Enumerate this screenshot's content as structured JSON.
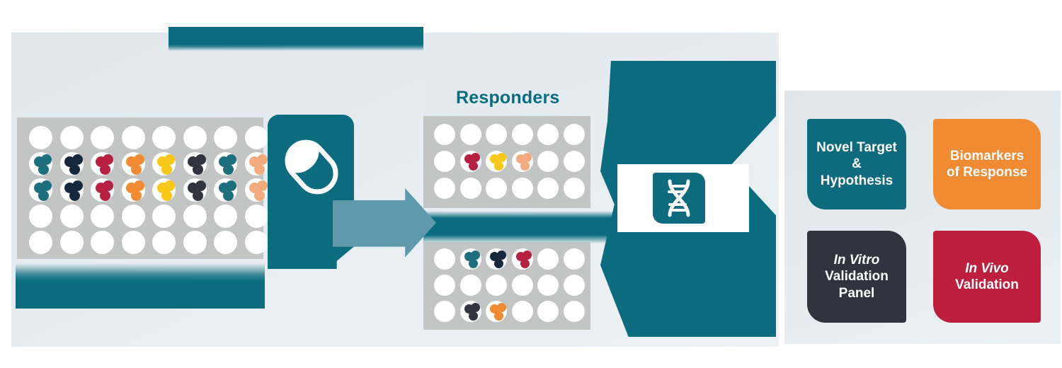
{
  "title": "Drug response screening to novel target discovery workflow",
  "colors": {
    "teal": "#0a6c7e",
    "teal_card": "#0d6b7d",
    "orange": "#f08b33",
    "navy": "#31343f",
    "crimson": "#bd1f3c",
    "plate_gray": "#c3c4c4",
    "well_white": "#ffffff",
    "connector_blue": "#5e9aab",
    "panel_bg": "#e5ecf1"
  },
  "captions": {
    "responders": "Responders"
  },
  "clipped_text": {
    "top_strip": "",
    "bottom_strip": "",
    "mid_strip": ""
  },
  "icons": {
    "pill": "pill-capsule-icon",
    "dna": "dna-helix-icon"
  },
  "cell_colors": {
    "teal": "#1d6f7d",
    "navy": "#16283c",
    "crimson": "#b7203f",
    "orange": "#f08b33",
    "yellow": "#f9c717",
    "charcoal": "#31343f",
    "peach": "#f3ab7e"
  },
  "plates": {
    "main": {
      "name": "compound-screening-plate",
      "rows": 5,
      "cols": 8,
      "clusters": [
        {
          "row": 2,
          "col": 1,
          "color": "teal"
        },
        {
          "row": 2,
          "col": 2,
          "color": "navy"
        },
        {
          "row": 2,
          "col": 3,
          "color": "crimson"
        },
        {
          "row": 2,
          "col": 4,
          "color": "orange"
        },
        {
          "row": 2,
          "col": 5,
          "color": "yellow"
        },
        {
          "row": 2,
          "col": 6,
          "color": "charcoal"
        },
        {
          "row": 2,
          "col": 7,
          "color": "teal"
        },
        {
          "row": 2,
          "col": 8,
          "color": "peach"
        },
        {
          "row": 3,
          "col": 1,
          "color": "teal"
        },
        {
          "row": 3,
          "col": 2,
          "color": "navy"
        },
        {
          "row": 3,
          "col": 3,
          "color": "crimson"
        },
        {
          "row": 3,
          "col": 4,
          "color": "orange"
        },
        {
          "row": 3,
          "col": 5,
          "color": "yellow"
        },
        {
          "row": 3,
          "col": 6,
          "color": "charcoal"
        },
        {
          "row": 3,
          "col": 7,
          "color": "teal"
        },
        {
          "row": 3,
          "col": 8,
          "color": "peach"
        }
      ]
    },
    "responders": {
      "name": "responders-plate",
      "rows": 3,
      "cols": 6,
      "clusters": [
        {
          "row": 2,
          "col": 2,
          "color": "crimson"
        },
        {
          "row": 2,
          "col": 3,
          "color": "yellow"
        },
        {
          "row": 2,
          "col": 4,
          "color": "peach"
        }
      ]
    },
    "non_responders": {
      "name": "non-responders-plate",
      "rows": 3,
      "cols": 6,
      "clusters": [
        {
          "row": 1,
          "col": 2,
          "color": "teal"
        },
        {
          "row": 1,
          "col": 3,
          "color": "navy"
        },
        {
          "row": 1,
          "col": 4,
          "color": "crimson"
        },
        {
          "row": 3,
          "col": 2,
          "color": "charcoal"
        },
        {
          "row": 3,
          "col": 3,
          "color": "orange"
        }
      ]
    }
  },
  "outcome_cards": [
    {
      "id": "target",
      "line1": "Novel Target",
      "line2": "& Hypothesis",
      "italic_line": "",
      "color": "#0d6b7d"
    },
    {
      "id": "biomk",
      "line1": "Biomarkers",
      "line2": "of Response",
      "italic_line": "",
      "color": "#f08b33"
    },
    {
      "id": "invitro",
      "line1": "Validation",
      "line2": "Panel",
      "italic_line": "In Vitro",
      "color": "#31343f"
    },
    {
      "id": "invivo",
      "line1": "Validation",
      "line2": "",
      "italic_line": "In Vivo",
      "color": "#bd1f3c"
    }
  ]
}
